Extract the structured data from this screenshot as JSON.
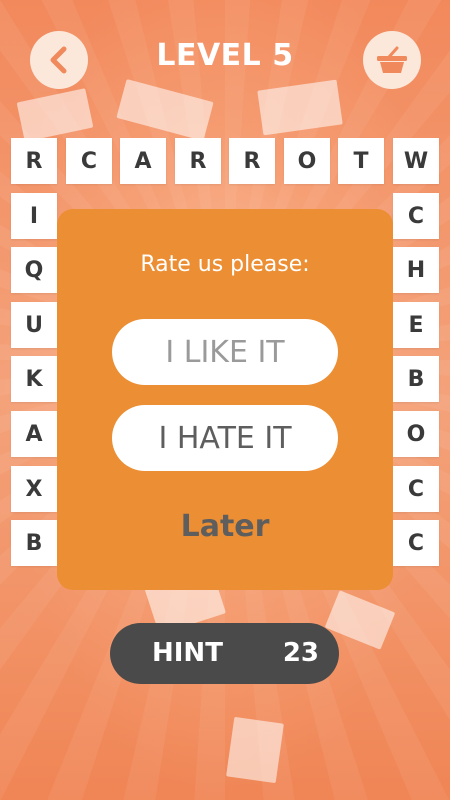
{
  "header": {
    "title": "LEVEL 5",
    "back_icon": "chevron-left-icon",
    "shop_icon": "basket-icon",
    "accent_color": "#f08a5d"
  },
  "grid": {
    "top_row": [
      "R",
      "C",
      "A",
      "R",
      "R",
      "O",
      "T",
      "W"
    ],
    "left_column": [
      "I",
      "Q",
      "U",
      "K",
      "A",
      "X",
      "B"
    ],
    "right_column": [
      "C",
      "H",
      "E",
      "B",
      "O",
      "C",
      "C"
    ]
  },
  "dialog": {
    "title": "Rate us please:",
    "like_label": "I LIKE IT",
    "hate_label": "I HATE IT",
    "later_label": "Later",
    "background_color": "#ec8e33"
  },
  "hint": {
    "label": "HINT",
    "count": "23"
  }
}
